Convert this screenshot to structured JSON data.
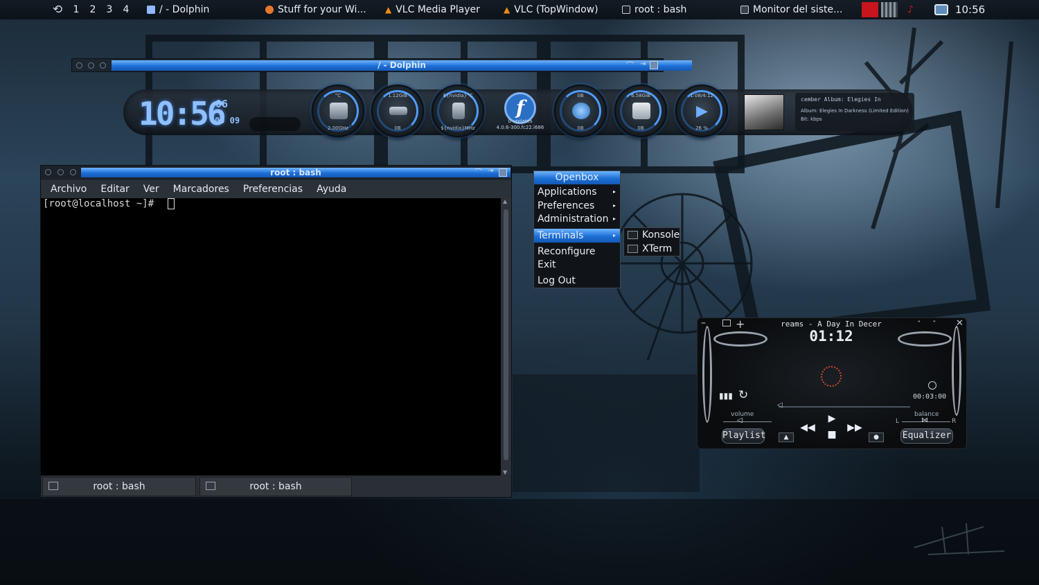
{
  "top_panel": {
    "launcher_glyph": "⟲",
    "workspaces": [
      "1",
      "2",
      "3",
      "4"
    ],
    "tasks": [
      {
        "label": "/ - Dolphin",
        "icon": "folder-icon",
        "color": "#8fb8ff"
      },
      {
        "label": "Stuff for your Wi...",
        "icon": "firefox-icon",
        "color": "#e8772e"
      },
      {
        "label": "VLC Media Player",
        "icon": "vlc-cone-icon",
        "color": "#f28a12"
      },
      {
        "label": "VLC (TopWindow)",
        "icon": "vlc-cone-icon",
        "color": "#f28a12"
      },
      {
        "label": "root : bash",
        "icon": "terminal-icon",
        "color": "#c8d2dc"
      },
      {
        "label": "Monitor del siste...",
        "icon": "monitor-icon",
        "color": "#c8d2dc"
      }
    ],
    "clock": "10:56"
  },
  "dolphin": {
    "title": "/ - Dolphin"
  },
  "conky": {
    "clock_main": "10:56",
    "clock_seconds": "06",
    "clock_date": "00 09",
    "gauges": [
      {
        "top": "°C",
        "bottom": "2.00GHz",
        "icon": "cpu-chip-icon"
      },
      {
        "top": "1.12GiB",
        "bottom": "0B",
        "icon": "ram-icon"
      },
      {
        "top": "${nvidia}°C",
        "bottom": "${nvidia}MHz",
        "icon": "gpu-icon"
      },
      {
        "top": "0B",
        "bottom": "0B",
        "icon": "network-globe-icon"
      },
      {
        "top": "6.58GiB",
        "bottom": "0B",
        "icon": "hard-drive-icon"
      },
      {
        "top": "1:08/4:12",
        "bottom": "26 %",
        "icon": "play-icon"
      }
    ],
    "fedora": {
      "letter": "f",
      "updates": "0 updates",
      "kernel": "4.0.6-300.fc22.i686"
    },
    "album_info": {
      "line1": "cember Album:  Elegies In",
      "line2": "Album:  Elegies In Darkness (Limited Edition)",
      "line3": "Bit:  kbps"
    }
  },
  "terminal": {
    "title": "root : bash",
    "menu": [
      "Archivo",
      "Editar",
      "Ver",
      "Marcadores",
      "Preferencias",
      "Ayuda"
    ],
    "prompt": "[root@localhost ~]#",
    "tabs": [
      "root : bash",
      "root : bash"
    ]
  },
  "openbox_menu": {
    "title": "Openbox",
    "items": [
      {
        "label": "Applications",
        "submenu": true
      },
      {
        "label": "Preferences",
        "submenu": true
      },
      {
        "label": "Administration",
        "submenu": true
      },
      {
        "label": "Terminals",
        "submenu": true,
        "selected": true
      },
      {
        "label": "Reconfigure",
        "submenu": false
      },
      {
        "label": "Exit",
        "submenu": false
      },
      {
        "label": "Log Out",
        "submenu": false
      }
    ],
    "terminals_submenu": [
      "Konsole",
      "XTerm"
    ]
  },
  "media_player": {
    "song": "reams - A Day In Decer",
    "time": "01:12",
    "elapsed_readout": "00:03:00",
    "volume_label": "volume",
    "balance_label": "balance",
    "balance_left": "L",
    "balance_right": "R",
    "playlist_label": "Playlist",
    "equalizer_label": "Equalizer"
  },
  "colors": {
    "accent_blue": "#1c6fd6",
    "conky_blue": "#8fc0ff"
  }
}
